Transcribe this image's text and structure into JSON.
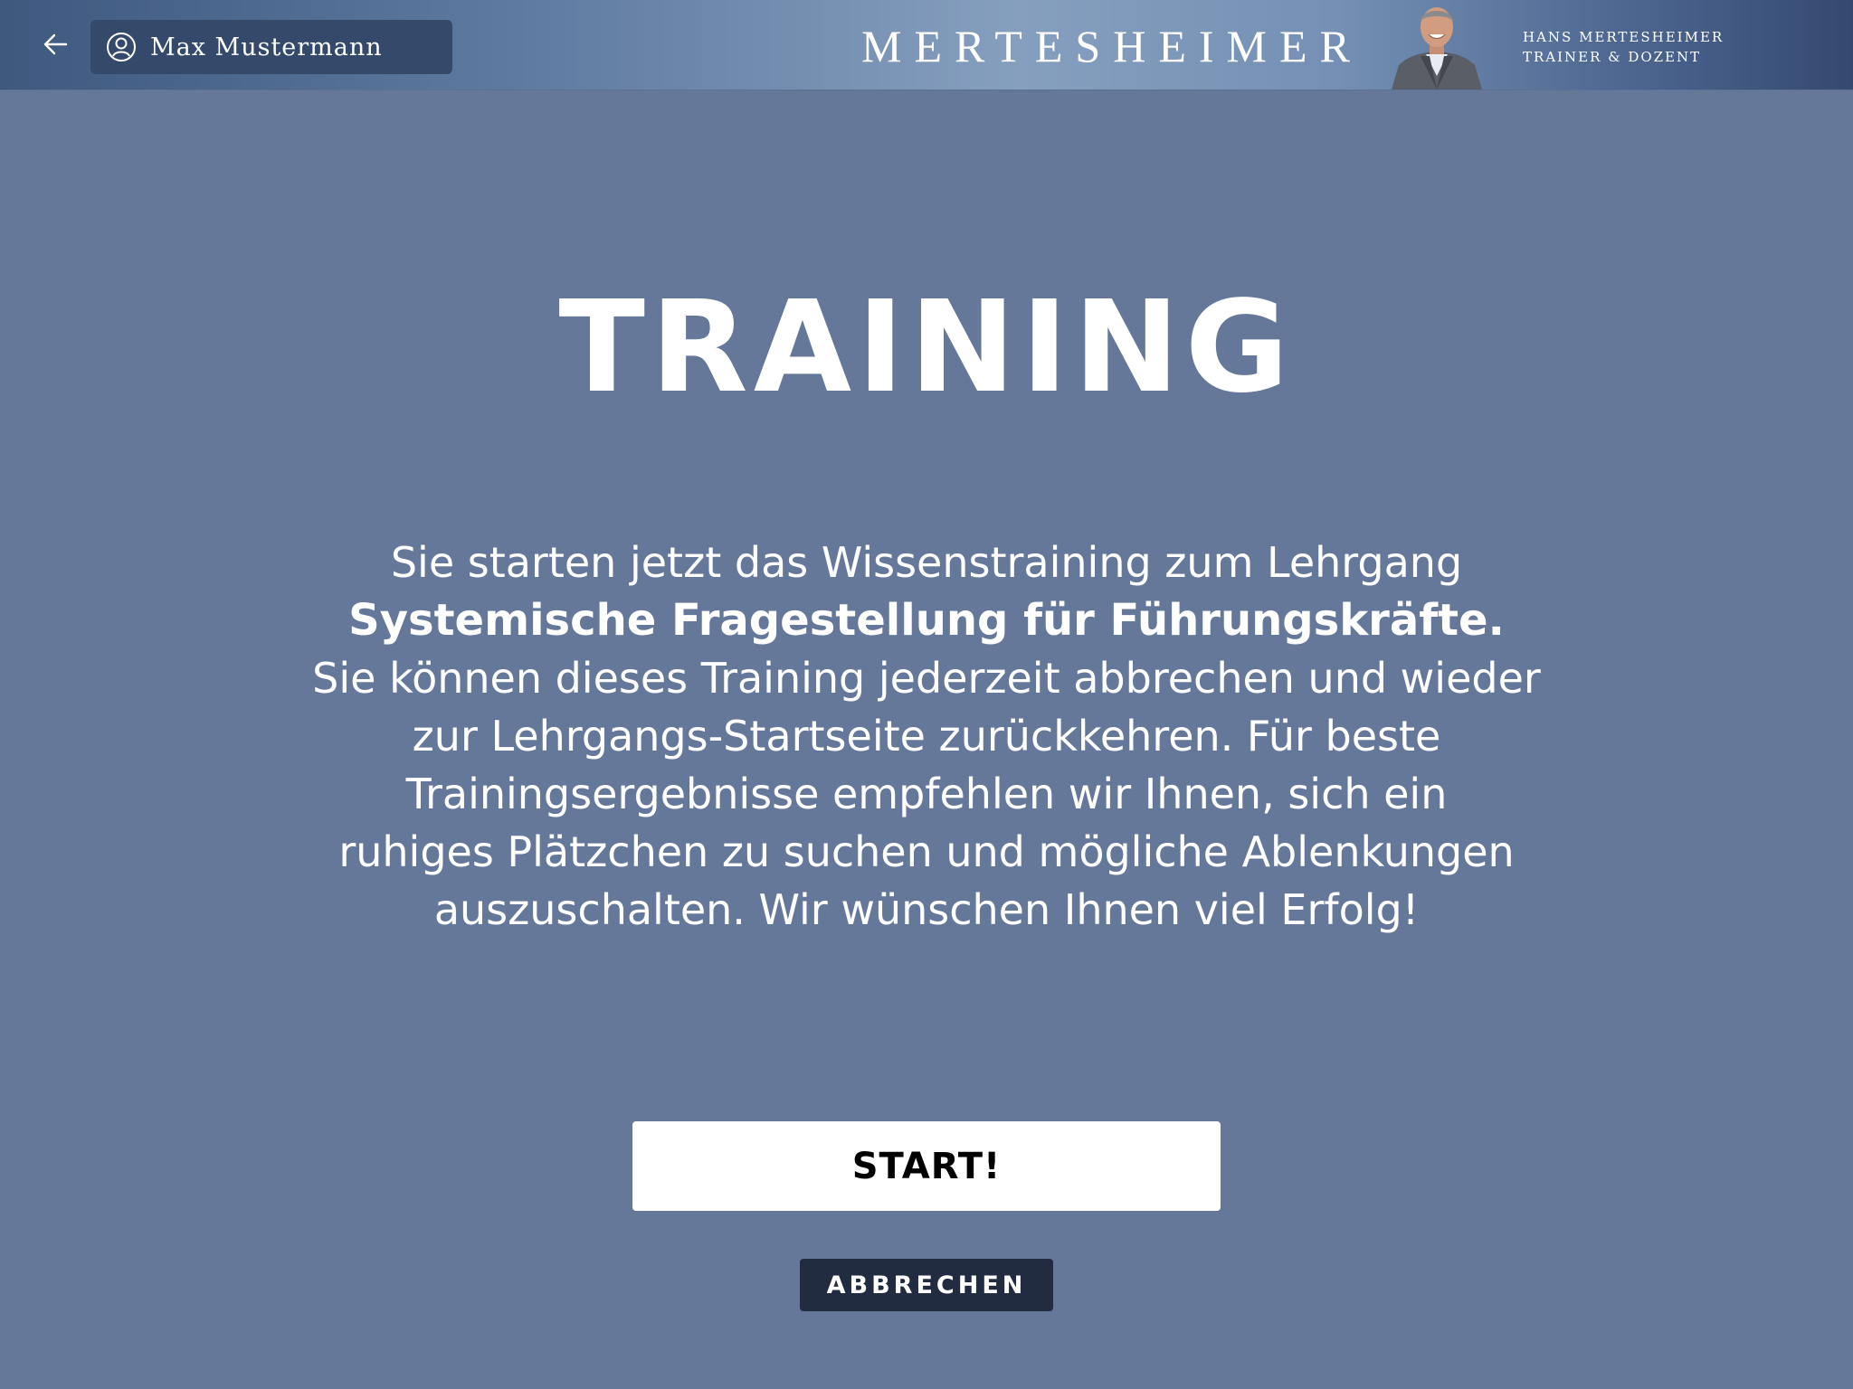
{
  "header": {
    "back_icon": "arrow-left-icon",
    "user": {
      "icon": "user-circle-icon",
      "name": "Max Mustermann"
    },
    "brand": "MERTESHEIMER",
    "trainer": {
      "name": "HANS MERTESHEIMER",
      "role": "TRAINER & DOZENT"
    }
  },
  "main": {
    "title": "TRAINING",
    "intro": {
      "line1": "Sie starten jetzt das Wissenstraining zum Lehrgang",
      "course_name": "Systemische Fragestellung für Führungskräfte.",
      "line3": "Sie können dieses Training jederzeit abbrechen und wieder",
      "line4": "zur Lehrgangs-Startseite zurückkehren. Für beste",
      "line5": "Trainingsergebnisse empfehlen wir Ihnen, sich ein",
      "line6": "ruhiges Plätzchen zu suchen und mögliche Ablenkungen",
      "line7": "auszuschalten. Wir wünschen Ihnen viel Erfolg!"
    },
    "start_label": "START!",
    "cancel_label": "ABBRECHEN"
  },
  "colors": {
    "background": "#65789a",
    "user_chip": "#354a6b",
    "cancel_button": "#222c41",
    "start_button": "#ffffff"
  }
}
